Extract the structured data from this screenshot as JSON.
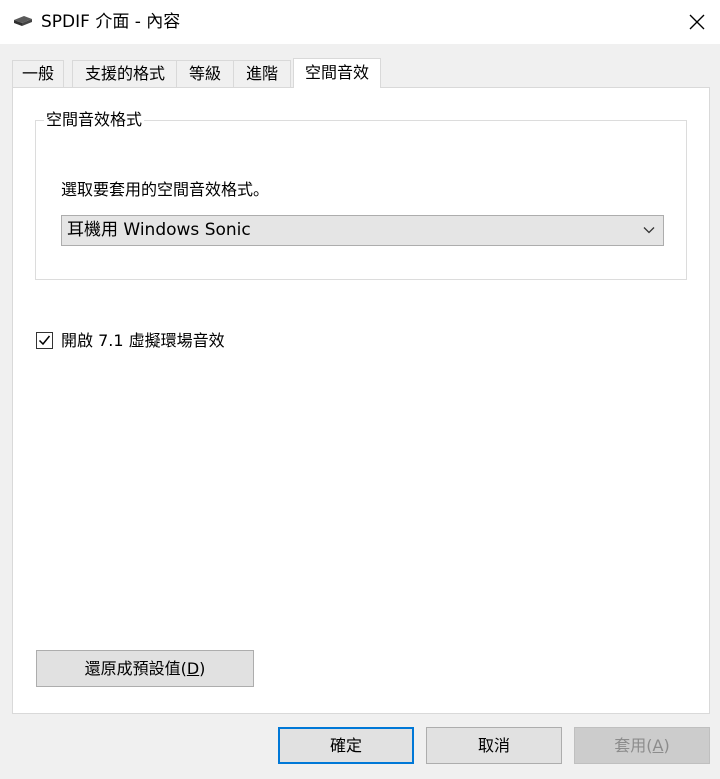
{
  "window": {
    "title": "SPDIF 介面 - 內容"
  },
  "tabs": [
    {
      "label": "一般"
    },
    {
      "label": "支援的格式"
    },
    {
      "label": "等級"
    },
    {
      "label": "進階"
    },
    {
      "label": "空間音效",
      "active": true
    }
  ],
  "spatial": {
    "group_title": "空間音效格式",
    "description": "選取要套用的空間音效格式。",
    "format_selected": "耳機用 Windows Sonic",
    "checkbox_label": "開啟 7.1 虛擬環場音效",
    "checkbox_checked": true
  },
  "buttons": {
    "restore_prefix": "還原成預設值(",
    "restore_accel": "D",
    "restore_suffix": ")",
    "ok": "確定",
    "cancel": "取消",
    "apply_prefix": "套用(",
    "apply_accel": "A",
    "apply_suffix": ")"
  },
  "colors": {
    "default_button_border": "#0078d7",
    "panel_bg": "#ffffff",
    "window_bg": "#f0f0f0"
  },
  "icons": {
    "title": "speaker-device-icon",
    "close": "close-icon",
    "dropdown": "chevron-down-icon",
    "check": "checkmark-icon"
  }
}
